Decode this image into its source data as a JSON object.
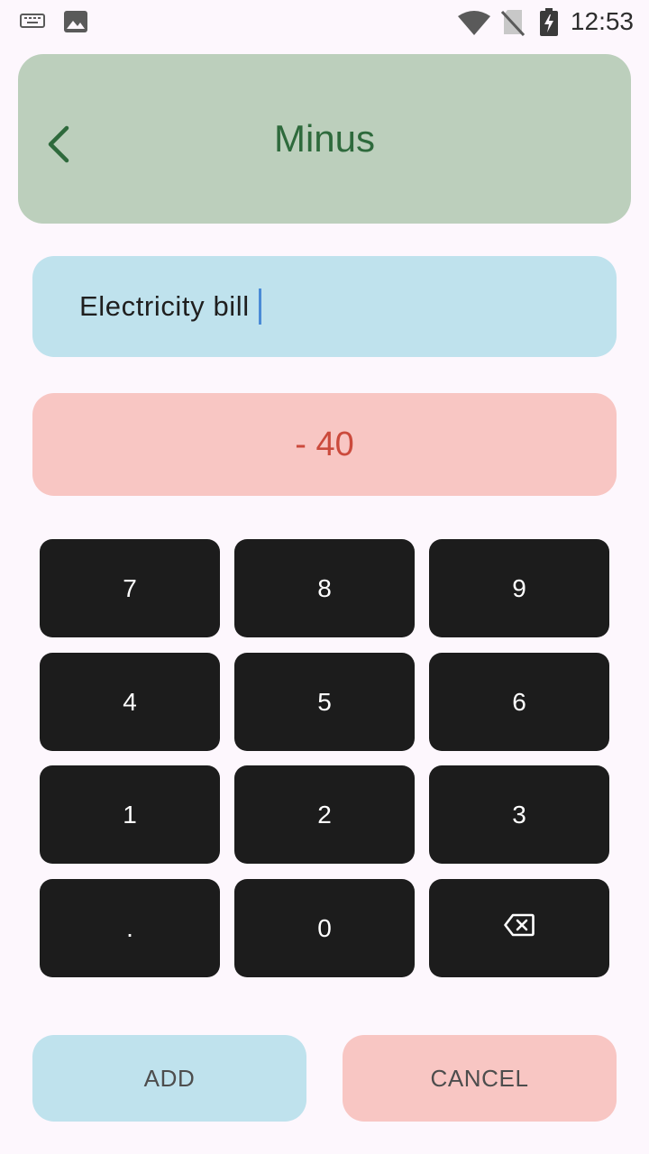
{
  "status_bar": {
    "time": "12:53",
    "left_icons": [
      "keyboard-icon",
      "image-icon"
    ],
    "right_icons": [
      "wifi-icon",
      "no-sim-icon",
      "battery-charging-icon"
    ]
  },
  "app_bar": {
    "title": "Minus",
    "back_icon": "chevron-left-icon",
    "background": "#bccfbc",
    "title_color": "#2e6a3c"
  },
  "description_field": {
    "value": "Electricity bill"
  },
  "amount": {
    "display": "- 40",
    "color": "#cb4a3c"
  },
  "keypad": {
    "keys": [
      {
        "label": "7"
      },
      {
        "label": "8"
      },
      {
        "label": "9"
      },
      {
        "label": "4"
      },
      {
        "label": "5"
      },
      {
        "label": "6"
      },
      {
        "label": "1"
      },
      {
        "label": "2"
      },
      {
        "label": "3"
      },
      {
        "label": "."
      },
      {
        "label": "0"
      },
      {
        "label": "",
        "icon": "backspace-icon"
      }
    ]
  },
  "actions": {
    "add_label": "ADD",
    "cancel_label": "CANCEL"
  }
}
